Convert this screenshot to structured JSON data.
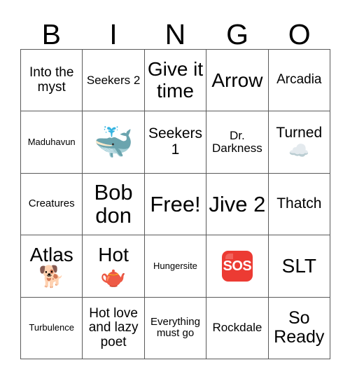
{
  "card": {
    "header_letters": [
      "B",
      "I",
      "N",
      "G",
      "O"
    ],
    "free_space_label": "Free!",
    "rows": [
      [
        {
          "text": "Into the myst",
          "size": "fs-ml",
          "emoji": "",
          "emoji_name": ""
        },
        {
          "text": "Seekers 2",
          "size": "fs-m",
          "emoji": "",
          "emoji_name": ""
        },
        {
          "text": "Give it time",
          "size": "fs-xxl",
          "emoji": "",
          "emoji_name": ""
        },
        {
          "text": "Arrow",
          "size": "fs-xxl",
          "emoji": "",
          "emoji_name": ""
        },
        {
          "text": "Arcadia",
          "size": "fs-ml",
          "emoji": "",
          "emoji_name": ""
        }
      ],
      [
        {
          "text": "Maduhavun",
          "size": "fs-xs",
          "emoji": "",
          "emoji_name": ""
        },
        {
          "text": "",
          "size": "fs-m",
          "emoji": "🐳",
          "emoji_name": "spouting-whale-emoji"
        },
        {
          "text": "Seekers 1",
          "size": "fs-l",
          "emoji": "",
          "emoji_name": ""
        },
        {
          "text": "Dr. Darkness",
          "size": "fs-m",
          "emoji": "",
          "emoji_name": ""
        },
        {
          "text": "Turned",
          "size": "fs-l",
          "emoji": "☁️",
          "emoji_name": "cloud-emoji"
        }
      ],
      [
        {
          "text": "Creatures",
          "size": "fs-s",
          "emoji": "",
          "emoji_name": ""
        },
        {
          "text": "Bob don",
          "size": "fs-huge",
          "emoji": "",
          "emoji_name": ""
        },
        {
          "text": "Free!",
          "size": "fs-huge",
          "emoji": "",
          "emoji_name": ""
        },
        {
          "text": "Jive 2",
          "size": "fs-huge",
          "emoji": "",
          "emoji_name": ""
        },
        {
          "text": "Thatch",
          "size": "fs-l",
          "emoji": "",
          "emoji_name": ""
        }
      ],
      [
        {
          "text": "Atlas",
          "size": "fs-xxl",
          "emoji": "🐕",
          "emoji_name": "dog-emoji"
        },
        {
          "text": "Hot",
          "size": "fs-xxl",
          "emoji": "🫖",
          "emoji_name": "teapot-emoji"
        },
        {
          "text": "Hungersite",
          "size": "fs-xs",
          "emoji": "",
          "emoji_name": ""
        },
        {
          "text": "",
          "size": "fs-m",
          "emoji": "🆘",
          "emoji_name": "sos-button-emoji"
        },
        {
          "text": "SLT",
          "size": "fs-xxl",
          "emoji": "",
          "emoji_name": ""
        }
      ],
      [
        {
          "text": "Turbulence",
          "size": "fs-xs",
          "emoji": "",
          "emoji_name": ""
        },
        {
          "text": "Hot love and lazy poet",
          "size": "fs-ml",
          "emoji": "",
          "emoji_name": ""
        },
        {
          "text": "Everything must go",
          "size": "fs-s",
          "emoji": "",
          "emoji_name": ""
        },
        {
          "text": "Rockdale",
          "size": "fs-m",
          "emoji": "",
          "emoji_name": ""
        },
        {
          "text": "So Ready",
          "size": "fs-xl",
          "emoji": "",
          "emoji_name": ""
        }
      ]
    ]
  },
  "colors": {
    "border": "#5a5a5a",
    "text": "#000000",
    "background": "#ffffff",
    "sos_red": "#ec3b33"
  }
}
